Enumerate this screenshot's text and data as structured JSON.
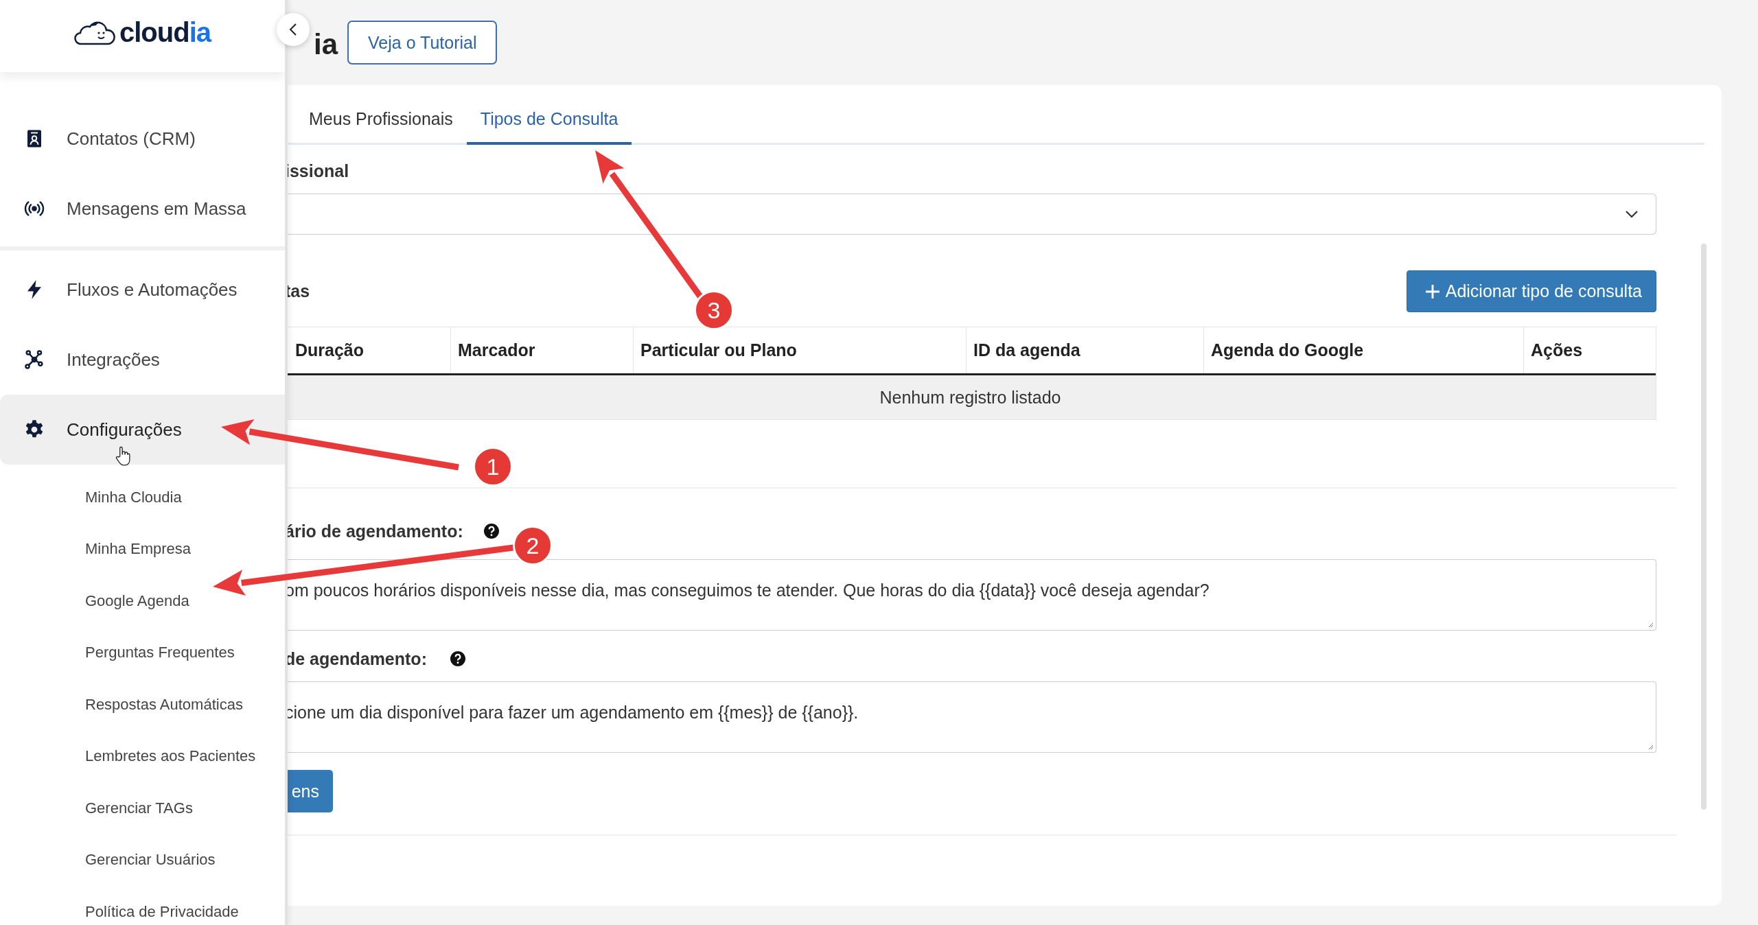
{
  "sidebar": {
    "logo": {
      "parts": [
        {
          "text": "cloud",
          "accent": false
        },
        {
          "text": "ia",
          "accent": true
        }
      ]
    },
    "groups": [
      {
        "items": [
          {
            "label": "Contatos (CRM)",
            "kind": "contact",
            "selected": false
          },
          {
            "label": "Mensagens em Massa",
            "kind": "broadcast",
            "selected": false
          }
        ]
      },
      {
        "items": [
          {
            "label": "Fluxos e Automações",
            "kind": "bolt",
            "selected": false
          },
          {
            "label": "Integrações",
            "kind": "network",
            "selected": false
          },
          {
            "label": "Configurações",
            "kind": "gear",
            "selected": true,
            "expanded": true,
            "children": [
              {
                "label": "Minha Cloudia",
                "selected": false
              },
              {
                "label": "Minha Empresa",
                "selected": false
              },
              {
                "label": "Google Agenda",
                "selected": false
              },
              {
                "label": "Perguntas Frequentes",
                "selected": false
              },
              {
                "label": "Respostas Automáticas",
                "selected": false
              },
              {
                "label": "Lembretes aos Pacientes",
                "selected": false
              },
              {
                "label": "Gerenciar TAGs",
                "selected": false
              },
              {
                "label": "Gerenciar Usuários",
                "selected": false
              },
              {
                "label": "Política de Privacidade",
                "selected": false
              }
            ]
          }
        ]
      }
    ]
  },
  "header": {
    "title": "ia",
    "tutorial_button": "Veja o Tutorial"
  },
  "tabs": [
    {
      "label": "Meus Profissionais",
      "selected": false
    },
    {
      "label": "Tipos de Consulta",
      "selected": true
    }
  ],
  "professional": {
    "label": "issional"
  },
  "consult_list": {
    "title": "tas",
    "add_button": "Adicionar tipo de consulta",
    "table": {
      "columns": [
        "Duração",
        "Marcador",
        "Particular ou Plano",
        "ID da agenda",
        "Agenda do Google",
        "Ações"
      ],
      "empty_message": "Nenhum registro listado"
    }
  },
  "messages": [
    {
      "label": "ário de agendamento:",
      "value": "om poucos horários disponíveis nesse dia, mas conseguimos te atender. Que horas do dia {{data}} você deseja agendar?"
    },
    {
      "label": "de agendamento:",
      "value": "cione um dia disponível para fazer um agendamento em {{mes}} de {{ano}}."
    }
  ],
  "save_button": "ens",
  "annotations": [
    {
      "number": "1"
    },
    {
      "number": "2"
    },
    {
      "number": "3"
    }
  ]
}
